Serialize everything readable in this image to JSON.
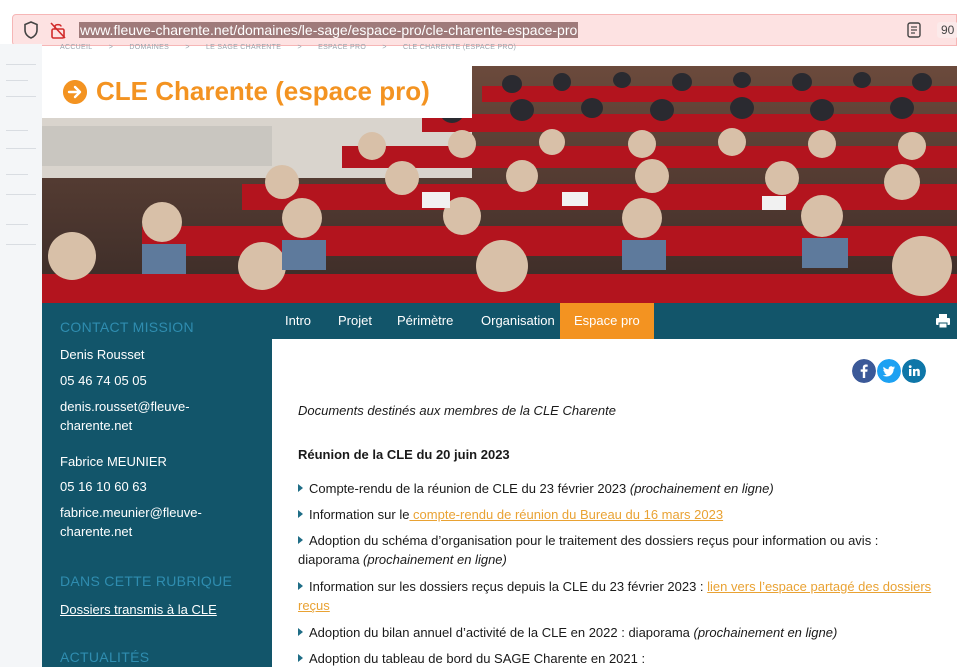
{
  "browser": {
    "url_prefix": "www.fleuve-charente.net",
    "url_path": "/domaines/le-sage/espace-pro/cle-charente-espace-pro",
    "zoom": "90"
  },
  "breadcrumb": [
    "ACCUEIL",
    ">",
    "DOMAINES",
    ">",
    "LE SAGE CHARENTE",
    ">",
    "ESPACE PRO",
    ">",
    "CLE CHARENTE (ESPACE PRO)"
  ],
  "page": {
    "title": "CLE Charente (espace pro)"
  },
  "sidebar": {
    "contact_heading": "CONTACT MISSION",
    "contact1_name": "Denis Rousset",
    "contact1_phone": "05 46 74 05 05",
    "contact1_email": "denis.rousset@fleuve-charente.net",
    "contact2_name": "Fabrice MEUNIER",
    "contact2_phone": "05 16 10 60 63",
    "contact2_email": "fabrice.meunier@fleuve-charente.net",
    "rubrique_heading": "DANS CETTE RUBRIQUE",
    "rubrique_link": "Dossiers transmis à la CLE",
    "news_heading": "ACTUALITÉS"
  },
  "tabs": [
    "Intro",
    "Projet",
    "Périmètre",
    "Organisation",
    "Espace pro"
  ],
  "content": {
    "intro": "Documents destinés aux membres de la CLE Charente",
    "section_title": "Réunion de la CLE du 20 juin 2023",
    "item1_text": "Compte-rendu de la réunion de CLE du 23 février 2023 ",
    "item1_em": "(prochainement en ligne)",
    "item2_text": "Information sur le",
    "item2_link": " compte-rendu de réunion du Bureau du 16 mars 2023",
    "item3_text": "Adoption du schéma d’organisation pour le traitement des dossiers reçus pour information ou avis : diaporama ",
    "item3_em": "(prochainement en ligne)",
    "item4_text": "Information sur les dossiers reçus depuis la CLE du 23 février 2023 : ",
    "item4_link": "lien vers l’espace partagé des dossiers reçus",
    "item5_text": "Adoption du bilan annuel d’activité de la CLE en 2022 : diaporama ",
    "item5_em": "(prochainement en ligne)",
    "item6_text": "Adoption du tableau de bord du SAGE Charente en 2021 :"
  },
  "colors": {
    "accent_orange": "#f39321",
    "sidebar_teal": "#12556a",
    "heading_blue": "#2f8db0",
    "link_gold": "#e9a233",
    "facebook": "#3b5998",
    "twitter": "#1da1f2",
    "linkedin": "#0e76a8"
  },
  "icons": {
    "shield": "shield-icon",
    "lock": "lock-slash-icon",
    "reader": "reader-view-icon",
    "title": "arrow-circle-right-icon",
    "print": "print-icon",
    "social": [
      "facebook-icon",
      "twitter-icon",
      "linkedin-icon"
    ]
  }
}
